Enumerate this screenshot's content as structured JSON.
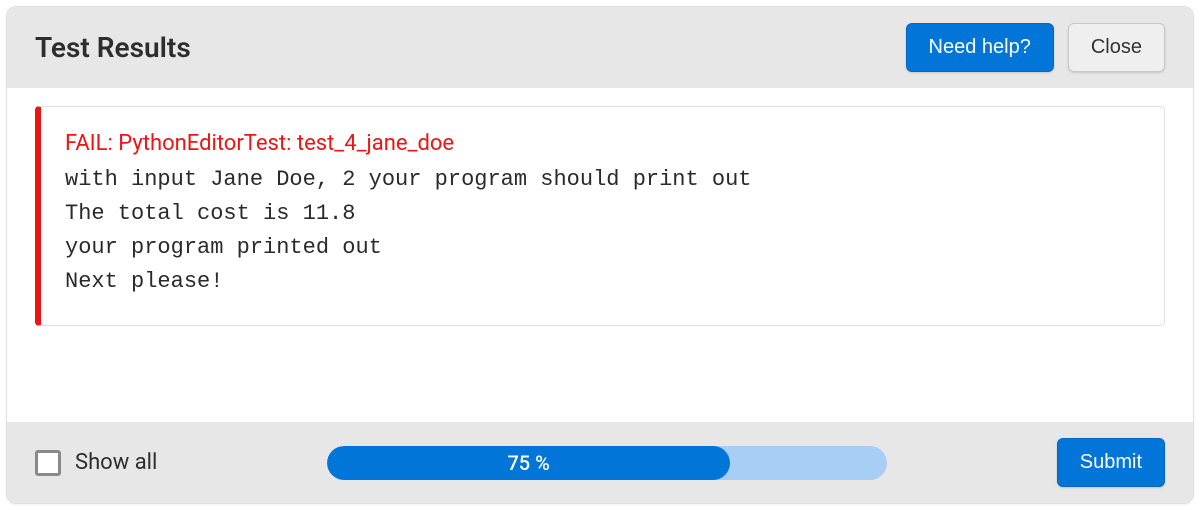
{
  "header": {
    "title": "Test Results",
    "help_label": "Need help?",
    "close_label": "Close"
  },
  "test": {
    "fail_title": "FAIL: PythonEditorTest: test_4_jane_doe",
    "message": "with input Jane Doe, 2 your program should print out\nThe total cost is 11.8\nyour program printed out\nNext please!"
  },
  "footer": {
    "show_all_label": "Show all",
    "show_all_checked": false,
    "progress_percent": 75,
    "progress_label": "75 %",
    "progress_fill_width": "72%",
    "submit_label": "Submit"
  },
  "colors": {
    "fail_accent": "#ec1515",
    "primary": "#0275d8",
    "progress_track": "#a8cef5",
    "panel_bg": "#e7e7e7"
  }
}
